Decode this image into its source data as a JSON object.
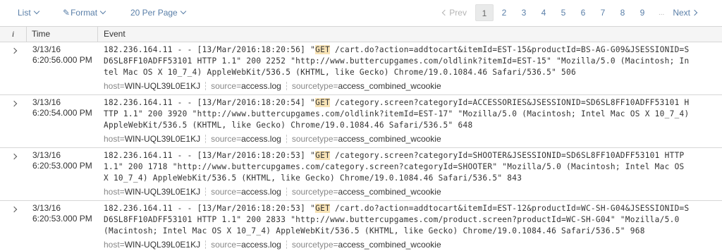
{
  "toolbar": {
    "list_label": "List",
    "format_label": "Format",
    "per_page_label": "20 Per Page"
  },
  "pager": {
    "prev_label": "Prev",
    "pages": [
      "1",
      "2",
      "3",
      "4",
      "5",
      "6",
      "7",
      "8",
      "9"
    ],
    "active_page": "1",
    "ellipsis": "...",
    "next_label": "Next"
  },
  "table": {
    "headers": {
      "info": "i",
      "time": "Time",
      "event": "Event"
    },
    "meta_keys": {
      "host": "host",
      "source": "source",
      "sourcetype": "sourcetype"
    },
    "rows": [
      {
        "date": "3/13/16",
        "time": "6:20:56.000 PM",
        "lines": [
          [
            "182.236.164.11 - - [13/Mar/2016:18:20:56] \"",
            "GET",
            " /cart.do?action=addtocart&itemId=EST-15&productId=BS-AG-G09&JSESSIONID=S"
          ],
          [
            "D6SL8FF10ADFF53101 HTTP 1.1\" 200 2252 \"http://www.buttercupgames.com/oldlink?itemId=EST-15\" \"Mozilla/5.0 (Macintosh; In"
          ],
          [
            "tel Mac OS X 10_7_4) AppleWebKit/536.5 (KHTML, like Gecko) Chrome/19.0.1084.46 Safari/536.5\" 506"
          ]
        ],
        "host": "WIN-UQL39L0E1KJ",
        "source": "access.log",
        "sourcetype": "access_combined_wcookie"
      },
      {
        "date": "3/13/16",
        "time": "6:20:54.000 PM",
        "lines": [
          [
            "182.236.164.11 - - [13/Mar/2016:18:20:54] \"",
            "GET",
            " /category.screen?categoryId=ACCESSORIES&JSESSIONID=SD6SL8FF10ADFF53101 H"
          ],
          [
            "TTP 1.1\" 200 3920 \"http://www.buttercupgames.com/oldlink?itemId=EST-17\" \"Mozilla/5.0 (Macintosh; Intel Mac OS X 10_7_4)"
          ],
          [
            "AppleWebKit/536.5 (KHTML, like Gecko) Chrome/19.0.1084.46 Safari/536.5\" 648"
          ]
        ],
        "host": "WIN-UQL39L0E1KJ",
        "source": "access.log",
        "sourcetype": "access_combined_wcookie"
      },
      {
        "date": "3/13/16",
        "time": "6:20:53.000 PM",
        "lines": [
          [
            "182.236.164.11 - - [13/Mar/2016:18:20:53] \"",
            "GET",
            " /category.screen?categoryId=SHOOTER&JSESSIONID=SD6SL8FF10ADFF53101 HTTP"
          ],
          [
            "1.1\" 200 1718 \"http://www.buttercupgames.com/category.screen?categoryId=SHOOTER\" \"Mozilla/5.0 (Macintosh; Intel Mac OS"
          ],
          [
            "X 10_7_4) AppleWebKit/536.5 (KHTML, like Gecko) Chrome/19.0.1084.46 Safari/536.5\" 843"
          ]
        ],
        "host": "WIN-UQL39L0E1KJ",
        "source": "access.log",
        "sourcetype": "access_combined_wcookie"
      },
      {
        "date": "3/13/16",
        "time": "6:20:53.000 PM",
        "lines": [
          [
            "182.236.164.11 - - [13/Mar/2016:18:20:53] \"",
            "GET",
            " /cart.do?action=addtocart&itemId=EST-12&productId=WC-SH-G04&JSESSIONID=S"
          ],
          [
            "D6SL8FF10ADFF53101 HTTP 1.1\" 200 2833 \"http://www.buttercupgames.com/product.screen?productId=WC-SH-G04\" \"Mozilla/5.0"
          ],
          [
            "(Macintosh; Intel Mac OS X 10_7_4) AppleWebKit/536.5 (KHTML, like Gecko) Chrome/19.0.1084.46 Safari/536.5\" 968"
          ]
        ],
        "host": "WIN-UQL39L0E1KJ",
        "source": "access.log",
        "sourcetype": "access_combined_wcookie"
      }
    ]
  },
  "colors": {
    "link": "#5a7fa8",
    "highlight": "#f8e3b5",
    "border": "#d6d6d6"
  },
  "icons": {
    "list_dropdown": "chevron-down-icon",
    "format": "pencil-icon",
    "expand": "chevron-right-icon"
  }
}
